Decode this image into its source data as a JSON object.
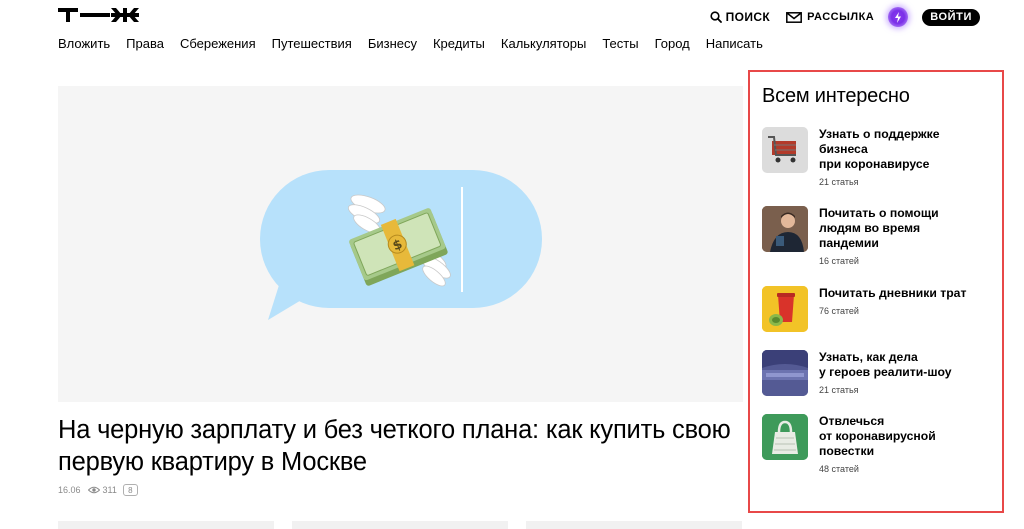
{
  "header": {
    "search_label": "ПОИСК",
    "newsletter_label": "РАССЫЛКА",
    "login_label": "ВОЙТИ"
  },
  "nav": {
    "items": [
      "Вложить",
      "Права",
      "Сбережения",
      "Путешествия",
      "Бизнесу",
      "Кредиты",
      "Калькуляторы",
      "Тесты",
      "Город",
      "Написать"
    ]
  },
  "article": {
    "title": "На черную зарплату и без четкого плана: как купить свою первую квартиру в Москве",
    "date": "16.06",
    "views": "311",
    "comments": "8"
  },
  "sidebar": {
    "title": "Всем интересно",
    "topics": [
      {
        "title": "Узнать о поддержке\nбизнеса\nпри коронавирусе",
        "count": "21 статья"
      },
      {
        "title": "Почитать о помощи\nлюдям во время\nпандемии",
        "count": "16 статей"
      },
      {
        "title": "Почитать дневники трат",
        "count": "76 статей"
      },
      {
        "title": "Узнать, как дела\nу героев реалити-шоу",
        "count": "21 статья"
      },
      {
        "title": "Отвлечься\nот коронавирусной\nповестки",
        "count": "48 статей"
      }
    ]
  },
  "colors": {
    "accent_border": "#e84848",
    "bubble": "#b7e1fb",
    "pro_badge": "#7a2fe8"
  }
}
